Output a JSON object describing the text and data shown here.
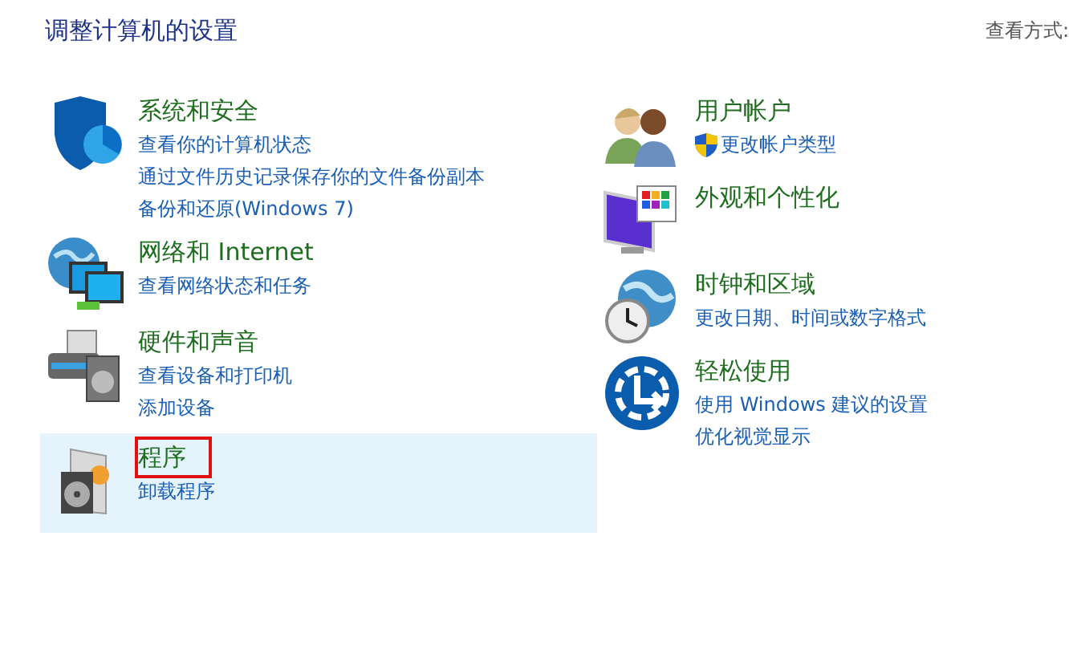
{
  "header": {
    "title": "调整计算机的设置",
    "view_label": "查看方式:"
  },
  "columns": [
    {
      "categories": [
        {
          "title": "系统和安全",
          "hovered": false,
          "outlined": false,
          "links": [
            {
              "text": "查看你的计算机状态",
              "shield": false
            },
            {
              "text": "通过文件历史记录保存你的文件备份副本",
              "shield": false
            },
            {
              "text": "备份和还原(Windows 7)",
              "shield": false
            }
          ]
        },
        {
          "title": "网络和 Internet",
          "hovered": false,
          "outlined": false,
          "links": [
            {
              "text": "查看网络状态和任务",
              "shield": false
            }
          ]
        },
        {
          "title": "硬件和声音",
          "hovered": false,
          "outlined": false,
          "links": [
            {
              "text": "查看设备和打印机",
              "shield": false
            },
            {
              "text": "添加设备",
              "shield": false
            }
          ]
        },
        {
          "title": "程序",
          "hovered": true,
          "outlined": true,
          "links": [
            {
              "text": "卸载程序",
              "shield": false
            }
          ]
        }
      ]
    },
    {
      "categories": [
        {
          "title": "用户帐户",
          "hovered": false,
          "outlined": false,
          "links": [
            {
              "text": "更改帐户类型",
              "shield": true
            }
          ]
        },
        {
          "title": "外观和个性化",
          "hovered": false,
          "outlined": false
        },
        {
          "title": "时钟和区域",
          "hovered": false,
          "outlined": false,
          "links": [
            {
              "text": "更改日期、时间或数字格式",
              "shield": false
            }
          ]
        },
        {
          "title": "轻松使用",
          "hovered": false,
          "outlined": false,
          "links": [
            {
              "text": "使用 Windows 建议的设置",
              "shield": false
            },
            {
              "text": "优化视觉显示",
              "shield": false
            }
          ]
        }
      ]
    }
  ]
}
